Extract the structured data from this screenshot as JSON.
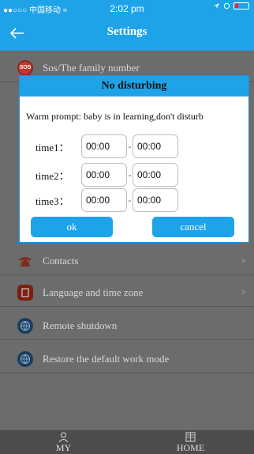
{
  "status_bar": {
    "carrier": "●●○○○ 中国移动 ≈",
    "time": "2:02 pm"
  },
  "header": {
    "title": "Settings"
  },
  "settings_items": [
    {
      "label": "Sos/The family number",
      "icon": "sos-icon",
      "badge": "SOS"
    },
    {
      "label": "Contacts",
      "icon": "phone-icon",
      "chevron": ">"
    },
    {
      "label": "Language and time zone",
      "icon": "book-icon",
      "chevron": ">"
    },
    {
      "label": "Remote shutdown",
      "icon": "globe-icon"
    },
    {
      "label": "Restore the default work mode",
      "icon": "globe-icon"
    }
  ],
  "dialog": {
    "title": "No disturbing",
    "prompt": "Warm prompt: baby is in learning,don't disturb",
    "rows": [
      {
        "label": "time1：",
        "start": "00:00",
        "end": "00:00"
      },
      {
        "label": "time2：",
        "start": "00:00",
        "end": "00:00"
      },
      {
        "label": "time3：",
        "start": "00:00",
        "end": "00:00"
      }
    ],
    "ok_label": "ok",
    "cancel_label": "cancel"
  },
  "tabbar": {
    "my_label": "MY",
    "home_label": "HOME"
  },
  "colors": {
    "accent": "#1fa3e8",
    "overlay_bg": "#6b6b6b",
    "tabbar_bg": "#4c4c4c"
  }
}
